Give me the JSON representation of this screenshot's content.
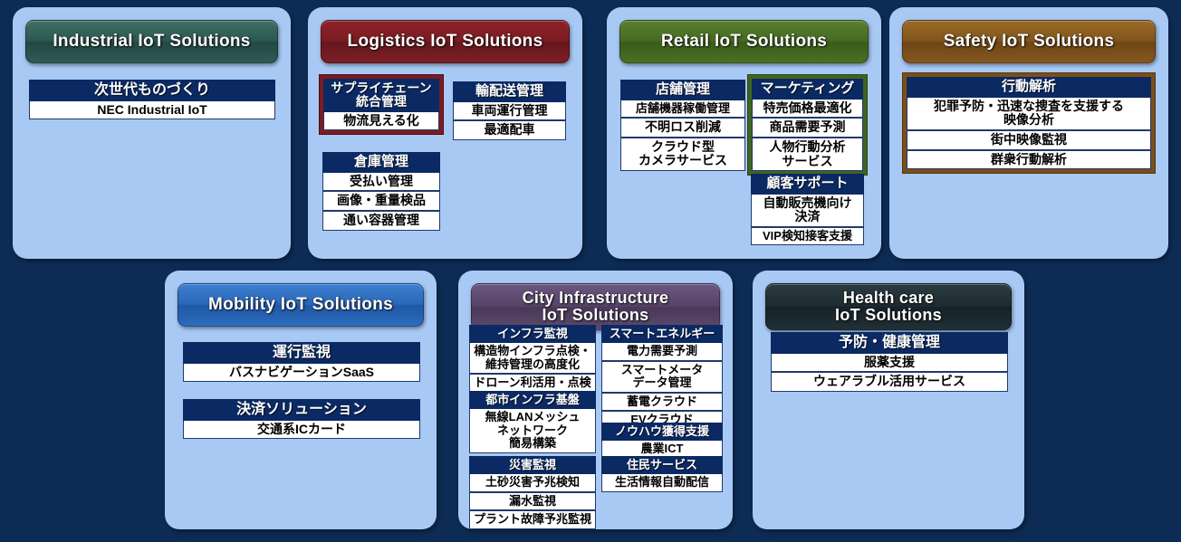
{
  "background_color": "#0d2c55",
  "panel_color": "#a9c9f5",
  "header_text_color": "#ffffff",
  "group_header_color": "#0b2a63",
  "panels": [
    {
      "id": "industrial",
      "title": "Industrial IoT Solutions",
      "accent": "#2c5751",
      "groups": [
        {
          "header": "次世代ものづくり",
          "items": [
            "NEC Industrial IoT"
          ]
        }
      ]
    },
    {
      "id": "logistics",
      "title": "Logistics IoT Solutions",
      "accent": "#7a1c22",
      "groups": [
        {
          "header": "サプライチェーン\n統合管理",
          "header_line1": "サプライチェーン",
          "header_line2": "統合管理",
          "framed": true,
          "items": [
            "物流見える化"
          ]
        },
        {
          "header": "輸配送管理",
          "items": [
            "車両運行管理",
            "最適配車"
          ]
        },
        {
          "header": "倉庫管理",
          "items": [
            "受払い管理",
            "画像・重量検品",
            "通い容器管理"
          ]
        }
      ]
    },
    {
      "id": "retail",
      "title": "Retail IoT Solutions",
      "accent": "#456a22",
      "groups": [
        {
          "header": "店舗管理",
          "items": [
            "店舗機器稼働管理",
            "不明ロス削減",
            "クラウド型\nカメラサービス"
          ]
        },
        {
          "header": "マーケティング",
          "framed": true,
          "items": [
            "特売価格最適化",
            "商品需要予測",
            "人物行動分析\nサービス"
          ]
        },
        {
          "header": "顧客サポート",
          "items": [
            "自動販売機向け\n決済",
            "VIP検知接客支援"
          ]
        }
      ]
    },
    {
      "id": "safety",
      "title": "Safety IoT Solutions",
      "accent": "#82551c",
      "groups": [
        {
          "header": "行動解析",
          "framed": true,
          "items": [
            "犯罪予防・迅速な捜査を支援する\n映像分析",
            "街中映像監視",
            "群衆行動解析"
          ]
        }
      ]
    },
    {
      "id": "mobility",
      "title": "Mobility IoT Solutions",
      "accent": "#2a67b8",
      "groups": [
        {
          "header": "運行監視",
          "items": [
            "バスナビゲーションSaaS"
          ]
        },
        {
          "header": "決済ソリューション",
          "items": [
            "交通系ICカード"
          ]
        }
      ]
    },
    {
      "id": "city",
      "title": "City Infrastructure\nIoT Solutions",
      "title_line1": "City Infrastructure",
      "title_line2": "IoT Solutions",
      "accent": "#584468",
      "groups": [
        {
          "header": "インフラ監視",
          "items": [
            "構造物インフラ点検・\n維持管理の高度化",
            "ドローン利活用・点検"
          ]
        },
        {
          "header": "都市インフラ基盤",
          "items": [
            "無線LANメッシュ\nネットワーク\n簡易構築"
          ]
        },
        {
          "header": "災害監視",
          "items": [
            "土砂災害予兆検知",
            "漏水監視",
            "プラント故障予兆監視"
          ]
        },
        {
          "header": "スマートエネルギー",
          "items": [
            "電力需要予測",
            "スマートメータ\nデータ管理",
            "蓄電クラウド",
            "EVクラウド"
          ]
        },
        {
          "header": "ノウハウ獲得支援",
          "items": [
            "農業ICT"
          ]
        },
        {
          "header": "住民サービス",
          "items": [
            "生活情報自動配信"
          ]
        }
      ]
    },
    {
      "id": "health",
      "title": "Health care\nIoT Solutions",
      "title_line1": "Health care",
      "title_line2": "IoT Solutions",
      "accent": "#1e2c31",
      "groups": [
        {
          "header": "予防・健康管理",
          "items": [
            "服薬支援",
            "ウェアラブル活用サービス"
          ]
        }
      ]
    }
  ]
}
